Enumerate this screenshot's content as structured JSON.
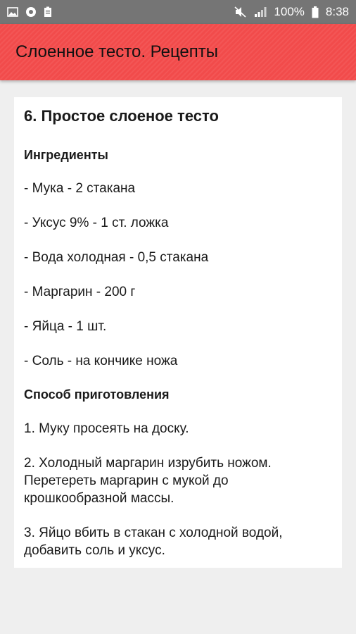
{
  "status_bar": {
    "battery": "100%",
    "time": "8:38",
    "icons": [
      "image-icon",
      "circle-app-icon",
      "clipboard-icon",
      "mute-icon",
      "signal-icon",
      "battery-icon"
    ]
  },
  "app_bar": {
    "title": "Слоенное тесто. Рецепты",
    "color": "#f24b4b"
  },
  "recipe": {
    "title": "6. Простое слоеное тесто",
    "ingredients_heading": "Ингредиенты",
    "ingredients": [
      "- Мука - 2 стакана",
      "- Уксус 9% - 1 ст. ложка",
      "- Вода холодная - 0,5 стакана",
      "- Маргарин - 200 г",
      "- Яйца - 1 шт.",
      "- Соль - на кончике ножа"
    ],
    "method_heading": "Способ приготовления",
    "steps": [
      "1. Муку просеять на доску.",
      "2. Холодный маргарин изрубить ножом. Перетереть маргарин с мукой до крошкообразной массы.",
      "3. Яйцо вбить в стакан с холодной водой, добавить соль и уксус."
    ]
  }
}
